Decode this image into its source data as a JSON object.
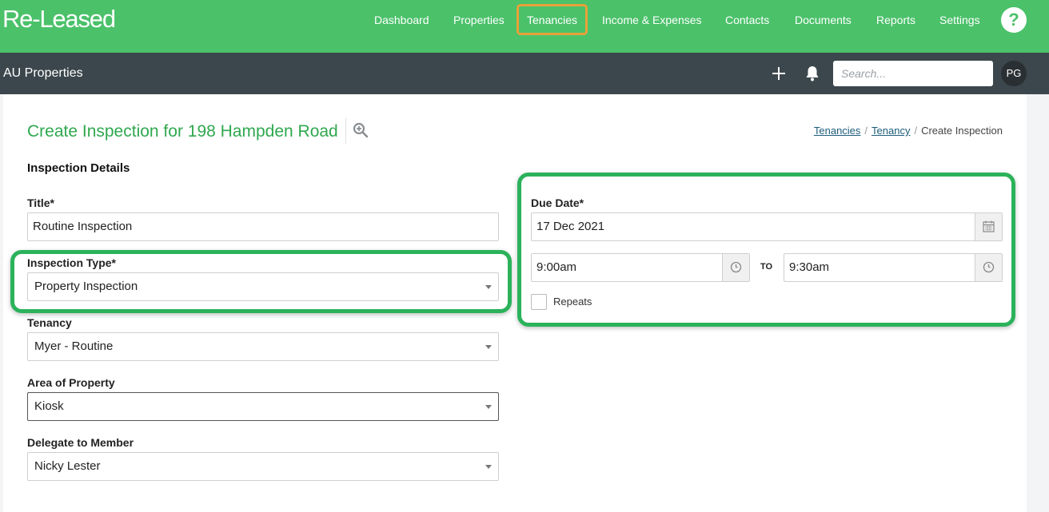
{
  "app": {
    "logo": "Re-Leased"
  },
  "nav": {
    "items": [
      {
        "label": "Dashboard"
      },
      {
        "label": "Properties"
      },
      {
        "label": "Tenancies"
      },
      {
        "label": "Income & Expenses"
      },
      {
        "label": "Contacts"
      },
      {
        "label": "Documents"
      },
      {
        "label": "Reports"
      },
      {
        "label": "Settings"
      }
    ],
    "active": "Tenancies",
    "help_label": "?"
  },
  "subbar": {
    "org_name": "AU Properties",
    "search_placeholder": "Search...",
    "avatar_initials": "PG"
  },
  "page": {
    "title": "Create Inspection for 198 Hampden Road",
    "breadcrumb": [
      {
        "label": "Tenancies",
        "link": true
      },
      {
        "label": "Tenancy",
        "link": true
      },
      {
        "label": "Create Inspection",
        "link": false
      }
    ],
    "breadcrumb_sep": "/"
  },
  "form": {
    "section_title": "Inspection Details",
    "title": {
      "label": "Title*",
      "value": "Routine Inspection"
    },
    "inspection_type": {
      "label": "Inspection Type*",
      "value": "Property Inspection"
    },
    "tenancy": {
      "label": "Tenancy",
      "value": "Myer - Routine"
    },
    "area": {
      "label": "Area of Property",
      "value": "Kiosk"
    },
    "delegate": {
      "label": "Delegate to Member",
      "value": "Nicky Lester"
    },
    "due_date": {
      "label": "Due Date*",
      "value": "17 Dec 2021"
    },
    "start_time": {
      "value": "9:00am"
    },
    "to_label": "TO",
    "end_time": {
      "value": "9:30am"
    },
    "repeats": {
      "label": "Repeats",
      "checked": false
    }
  },
  "colors": {
    "brand_green": "#4bc16a",
    "title_green": "#2fa84f",
    "active_outline": "#e7a13a",
    "highlight_green": "#2bb25b",
    "dark_bar": "#3c474d"
  },
  "icons": {
    "help": "question-icon",
    "add": "plus-icon",
    "notifications": "bell-icon",
    "zoom": "magnifier-plus-icon",
    "calendar": "calendar-icon",
    "clock": "clock-icon",
    "dropdown": "caret-down-icon"
  }
}
